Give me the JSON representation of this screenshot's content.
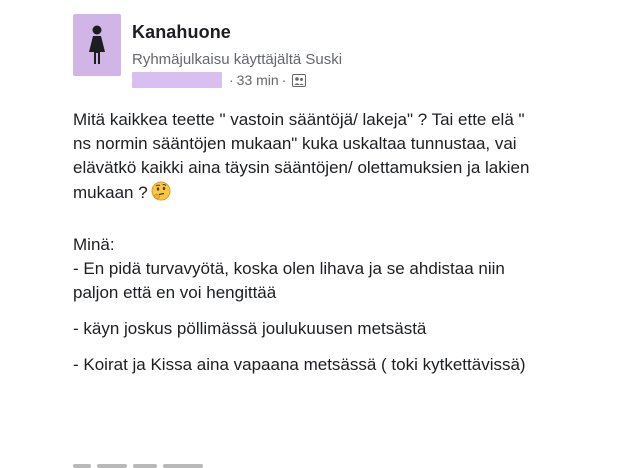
{
  "post": {
    "group_name": "Kanahuone",
    "subline": "Ryhmäjulkaisu käyttäjältä Suski",
    "time": "33 min",
    "separator": "·",
    "audience_icon": "group-icon",
    "avatar_icon": "female-silhouette-icon"
  },
  "body": {
    "paragraph1": "Mitä kaikkea teette \" vastoin sääntöjä/ lakeja\" ? Tai ette elä \" ns normin sääntöjen mukaan\" kuka uskaltaa tunnustaa, vai elävätkö kaikki aina täysin sääntöjen/ olettamuksien ja lakien mukaan ?",
    "paragraph1_emoji": "thinking-face-icon",
    "heading": "Minä:",
    "item1": "- En pidä turvavyötä, koska olen lihava ja se ahdistaa niin paljon että en voi hengittää",
    "item2": "- käyn joskus pöllimässä joulukuusen metsästä",
    "item3": "- Koirat ja Kissa aina vapaana metsässä ( toki kytkettävissä)"
  },
  "colors": {
    "avatar_bg": "#d1b5e6",
    "redaction": "#d8bff0",
    "text": "#1c1e21",
    "meta_text": "#65676b"
  }
}
